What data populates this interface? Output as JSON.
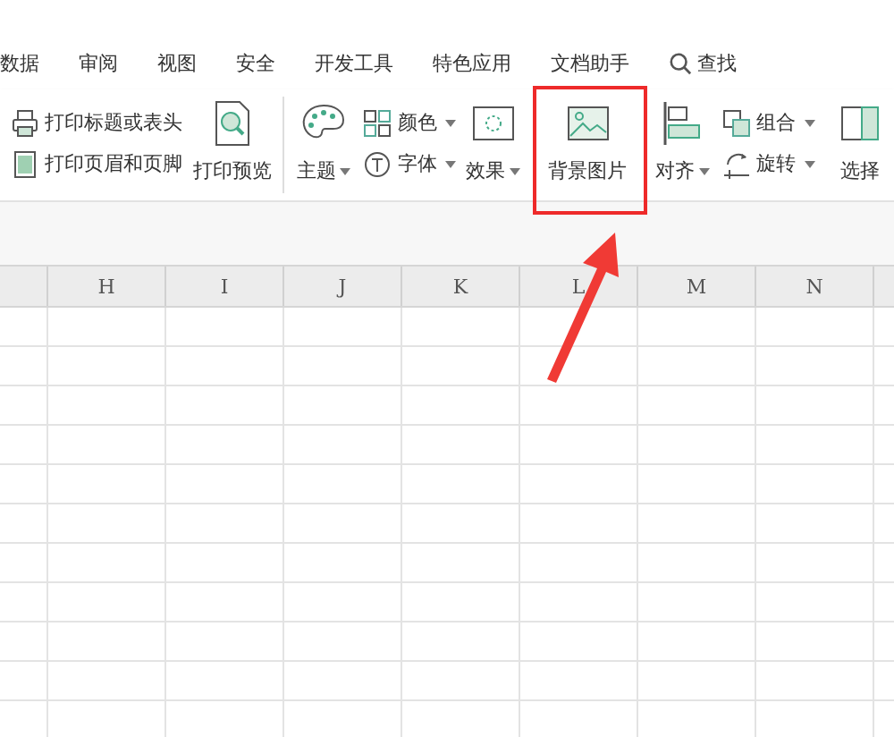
{
  "tabs": [
    {
      "label": "数据"
    },
    {
      "label": "审阅"
    },
    {
      "label": "视图"
    },
    {
      "label": "安全"
    },
    {
      "label": "开发工具"
    },
    {
      "label": "特色应用"
    },
    {
      "label": "文档助手"
    }
  ],
  "search": {
    "label": "查找"
  },
  "ribbon": [
    {
      "kind": "stack",
      "items": [
        {
          "label": "打印标题或表头",
          "dropdown": false
        },
        {
          "label": "打印页眉和页脚",
          "dropdown": false
        }
      ]
    },
    {
      "kind": "large",
      "label": "打印预览",
      "dropdown": false,
      "highlighted": false
    },
    {
      "kind": "separator"
    },
    {
      "kind": "large",
      "label": "主题",
      "dropdown": true,
      "highlighted": false
    },
    {
      "kind": "stack",
      "items": [
        {
          "label": "颜色",
          "dropdown": true
        },
        {
          "label": "字体",
          "dropdown": true
        }
      ]
    },
    {
      "kind": "large",
      "label": "效果",
      "dropdown": true,
      "highlighted": false
    },
    {
      "kind": "large",
      "label": "背景图片",
      "dropdown": false,
      "highlighted": true
    },
    {
      "kind": "large",
      "label": "对齐",
      "dropdown": true,
      "highlighted": false
    },
    {
      "kind": "stack",
      "items": [
        {
          "label": "组合",
          "dropdown": true
        },
        {
          "label": "旋转",
          "dropdown": true
        }
      ]
    },
    {
      "kind": "large",
      "label": "选择",
      "dropdown": false,
      "highlighted": false
    }
  ],
  "sheet": {
    "columns": [
      "H",
      "I",
      "J",
      "K",
      "L",
      "M",
      "N"
    ]
  }
}
